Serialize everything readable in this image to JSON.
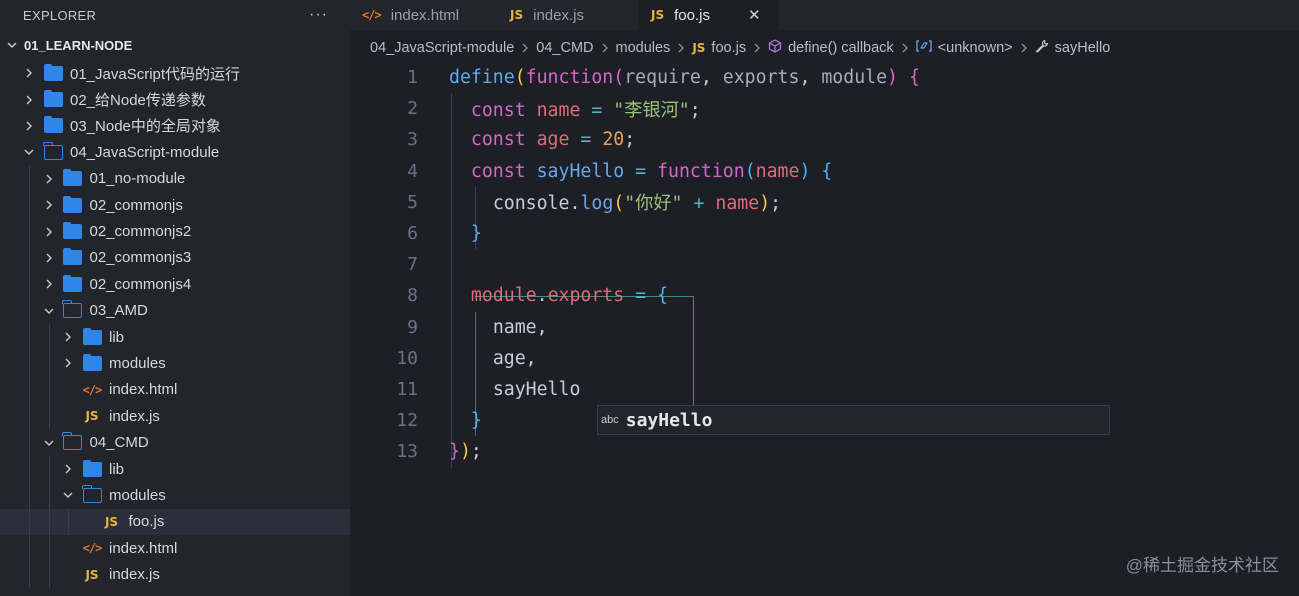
{
  "explorer": {
    "title": "EXPLORER",
    "more": "···",
    "root": "01_LEARN-NODE",
    "items": [
      {
        "label": "01_JavaScript代码的运行",
        "type": "folder",
        "expanded": false,
        "depth": 0
      },
      {
        "label": "02_给Node传递参数",
        "type": "folder",
        "expanded": false,
        "depth": 0
      },
      {
        "label": "03_Node中的全局对象",
        "type": "folder",
        "expanded": false,
        "depth": 0
      },
      {
        "label": "04_JavaScript-module",
        "type": "folder",
        "expanded": true,
        "depth": 0
      },
      {
        "label": "01_no-module",
        "type": "folder",
        "expanded": false,
        "depth": 1
      },
      {
        "label": "02_commonjs",
        "type": "folder",
        "expanded": false,
        "depth": 1
      },
      {
        "label": "02_commonjs2",
        "type": "folder",
        "expanded": false,
        "depth": 1
      },
      {
        "label": "02_commonjs3",
        "type": "folder",
        "expanded": false,
        "depth": 1
      },
      {
        "label": "02_commonjs4",
        "type": "folder",
        "expanded": false,
        "depth": 1
      },
      {
        "label": "03_AMD",
        "type": "folder",
        "expanded": true,
        "depth": 1
      },
      {
        "label": "lib",
        "type": "folder",
        "expanded": false,
        "depth": 2
      },
      {
        "label": "modules",
        "type": "folder",
        "expanded": false,
        "depth": 2
      },
      {
        "label": "index.html",
        "type": "html",
        "depth": 2
      },
      {
        "label": "index.js",
        "type": "js",
        "depth": 2
      },
      {
        "label": "04_CMD",
        "type": "folder",
        "expanded": true,
        "depth": 1
      },
      {
        "label": "lib",
        "type": "folder",
        "expanded": false,
        "depth": 2
      },
      {
        "label": "modules",
        "type": "folder",
        "expanded": true,
        "depth": 2
      },
      {
        "label": "foo.js",
        "type": "js",
        "depth": 3,
        "selected": true
      },
      {
        "label": "index.html",
        "type": "html",
        "depth": 2
      },
      {
        "label": "index.js",
        "type": "js",
        "depth": 2
      }
    ]
  },
  "tabs": [
    {
      "label": "index.html",
      "icon": "</>",
      "active": false
    },
    {
      "label": "index.js",
      "icon": "JS",
      "active": false
    },
    {
      "label": "foo.js",
      "icon": "JS",
      "active": true,
      "close": "✕"
    }
  ],
  "breadcrumb": [
    {
      "label": "04_JavaScript-module",
      "icon": ""
    },
    {
      "label": "04_CMD",
      "icon": ""
    },
    {
      "label": "modules",
      "icon": ""
    },
    {
      "label": "foo.js",
      "icon": "JS"
    },
    {
      "label": "define() callback",
      "icon": "cube"
    },
    {
      "label": "<unknown>",
      "icon": "var"
    },
    {
      "label": "sayHello",
      "icon": "wrench"
    }
  ],
  "editor": {
    "lines": [
      {
        "n": "1",
        "tokens": [
          [
            "fn",
            "define"
          ],
          [
            "br1",
            "("
          ],
          [
            "kw",
            "function"
          ],
          [
            "br2",
            "("
          ],
          [
            "pm",
            "require"
          ],
          [
            "tx",
            ", "
          ],
          [
            "pm",
            "exports"
          ],
          [
            "tx",
            ", "
          ],
          [
            "pm",
            "module"
          ],
          [
            "br2",
            ")"
          ],
          [
            "tx",
            " "
          ],
          [
            "br2",
            "{"
          ]
        ]
      },
      {
        "n": "2",
        "tokens": [
          [
            "tx",
            "  "
          ],
          [
            "kw",
            "const"
          ],
          [
            "tx",
            " "
          ],
          [
            "vr",
            "name"
          ],
          [
            "tx",
            " "
          ],
          [
            "op",
            "="
          ],
          [
            "tx",
            " "
          ],
          [
            "str",
            "\"李银河\""
          ],
          [
            "tx",
            ";"
          ]
        ]
      },
      {
        "n": "3",
        "tokens": [
          [
            "tx",
            "  "
          ],
          [
            "kw",
            "const"
          ],
          [
            "tx",
            " "
          ],
          [
            "vr",
            "age"
          ],
          [
            "tx",
            " "
          ],
          [
            "op",
            "="
          ],
          [
            "tx",
            " "
          ],
          [
            "num",
            "20"
          ],
          [
            "tx",
            ";"
          ]
        ]
      },
      {
        "n": "4",
        "tokens": [
          [
            "tx",
            "  "
          ],
          [
            "kw",
            "const"
          ],
          [
            "tx",
            " "
          ],
          [
            "fn",
            "sayHello"
          ],
          [
            "tx",
            " "
          ],
          [
            "op",
            "="
          ],
          [
            "tx",
            " "
          ],
          [
            "kw",
            "function"
          ],
          [
            "br3",
            "("
          ],
          [
            "vr",
            "name"
          ],
          [
            "br3",
            ")"
          ],
          [
            "tx",
            " "
          ],
          [
            "br3",
            "{"
          ]
        ]
      },
      {
        "n": "5",
        "tokens": [
          [
            "tx",
            "    "
          ],
          [
            "tx",
            "console"
          ],
          [
            "tx",
            "."
          ],
          [
            "fn",
            "log"
          ],
          [
            "br1",
            "("
          ],
          [
            "str",
            "\"你好\""
          ],
          [
            "tx",
            " "
          ],
          [
            "op",
            "+"
          ],
          [
            "tx",
            " "
          ],
          [
            "vr",
            "name"
          ],
          [
            "br1",
            ")"
          ],
          [
            "tx",
            ";"
          ]
        ]
      },
      {
        "n": "6",
        "tokens": [
          [
            "tx",
            "  "
          ],
          [
            "br3",
            "}"
          ]
        ]
      },
      {
        "n": "7",
        "tokens": []
      },
      {
        "n": "8",
        "tokens": [
          [
            "tx",
            "  "
          ],
          [
            "vr",
            "module"
          ],
          [
            "tx",
            "."
          ],
          [
            "vr",
            "exports"
          ],
          [
            "tx",
            " "
          ],
          [
            "op",
            "="
          ],
          [
            "tx",
            " "
          ],
          [
            "br3",
            "{"
          ]
        ]
      },
      {
        "n": "9",
        "tokens": [
          [
            "tx",
            "    "
          ],
          [
            "tx",
            "name,"
          ]
        ]
      },
      {
        "n": "10",
        "tokens": [
          [
            "tx",
            "    "
          ],
          [
            "tx",
            "age,"
          ]
        ]
      },
      {
        "n": "11",
        "tokens": [
          [
            "tx",
            "    "
          ],
          [
            "tx",
            "sayHello"
          ]
        ]
      },
      {
        "n": "12",
        "tokens": [
          [
            "tx",
            "  "
          ],
          [
            "br3",
            "}"
          ]
        ]
      },
      {
        "n": "13",
        "tokens": [
          [
            "br2",
            "}"
          ],
          [
            "br1",
            ")"
          ],
          [
            "tx",
            ";"
          ]
        ]
      }
    ]
  },
  "suggest": {
    "kind": "abc",
    "word": "sayHello"
  },
  "watermark": "@稀土掘金技术社区"
}
